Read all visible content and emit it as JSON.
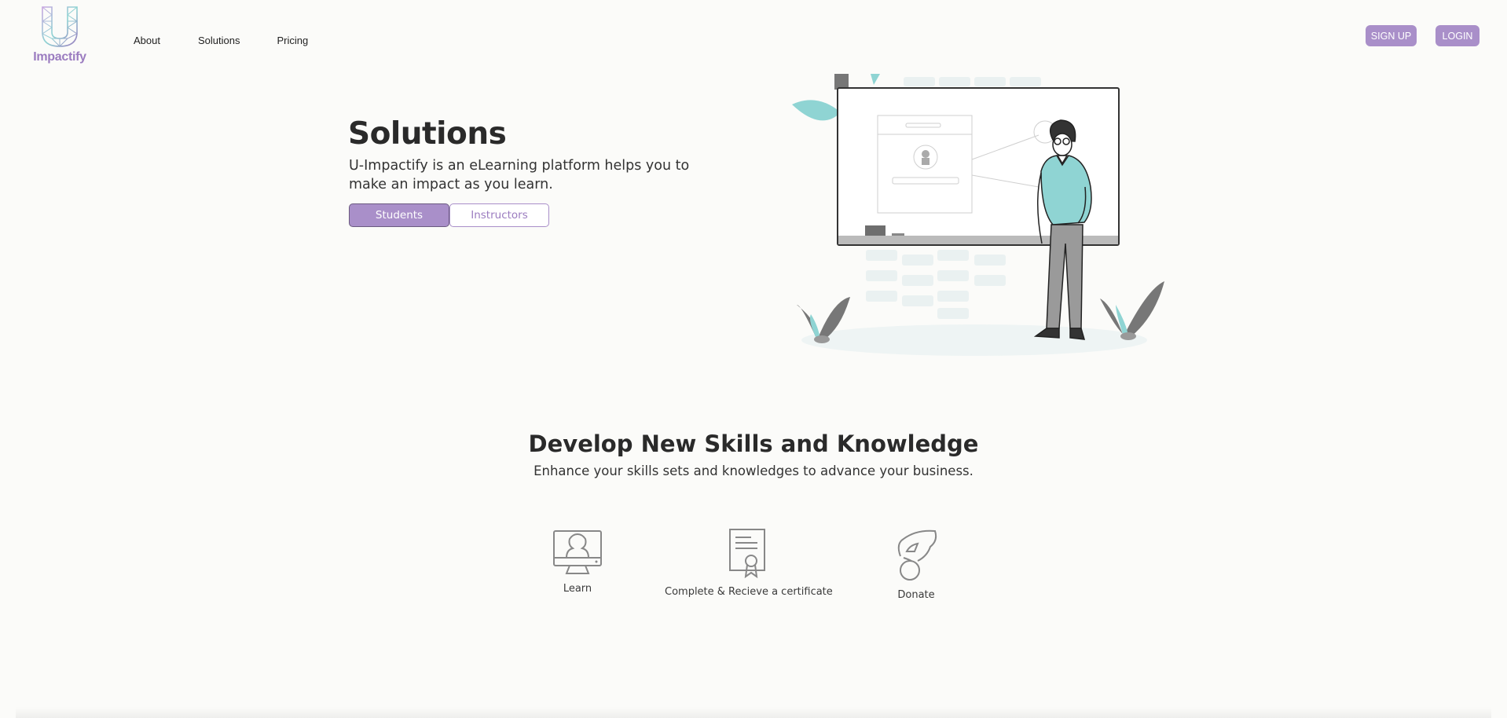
{
  "header": {
    "logo_text": "Impactify",
    "nav": [
      {
        "label": "About"
      },
      {
        "label": "Solutions"
      },
      {
        "label": "Pricing"
      }
    ],
    "signup_label": "SIGN UP",
    "login_label": "LOGIN"
  },
  "hero": {
    "title": "Solutions",
    "subtitle": "U-Impactify is an eLearning platform helps you to make an impact as you learn.",
    "toggle": {
      "students_label": "Students",
      "instructors_label": "Instructors",
      "selected": "Students"
    }
  },
  "skills": {
    "title": "Develop New Skills and Knowledge",
    "subtitle": "Enhance your skills sets and knowledges to advance your business.",
    "features": [
      {
        "label": "Learn",
        "icon": "learn-monitor-icon"
      },
      {
        "label": "Complete & Recieve a certificate",
        "icon": "certificate-icon"
      },
      {
        "label": "Donate",
        "icon": "donate-hand-icon"
      }
    ]
  },
  "colors": {
    "accent": "#a98fc9",
    "accent_text": "#9b7cc0",
    "background": "#fbfbf9",
    "illustration_teal": "#8fd4d3"
  }
}
